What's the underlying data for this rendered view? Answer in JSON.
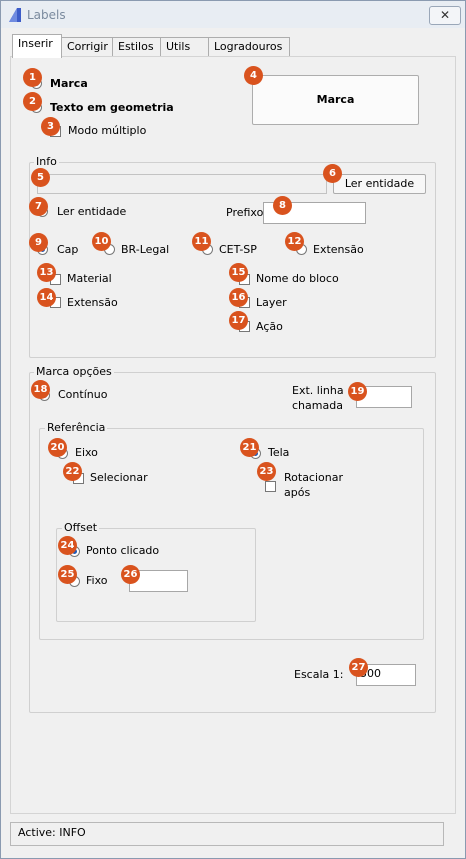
{
  "window": {
    "title": "Labels",
    "close_glyph": "✕"
  },
  "tabs": [
    {
      "label": "Inserir"
    },
    {
      "label": "Corrigir"
    },
    {
      "label": "Estilos"
    },
    {
      "label": "Utils"
    },
    {
      "label": "Logradouros"
    }
  ],
  "top": {
    "marca_label": "Marca",
    "texto_label": "Texto em geometria",
    "modo_label": "Modo múltiplo",
    "marca_button": "Marca"
  },
  "info": {
    "title": "Info",
    "field_value": "",
    "ler_button": "Ler entidade",
    "ler_radio": "Ler entidade",
    "prefixo_label": "Prefixo",
    "prefixo_value": "",
    "opts": {
      "cap": "Cap",
      "brlegal": "BR-Legal",
      "cetsp": "CET-SP",
      "extensao": "Extensão",
      "material": "Material",
      "extensao2": "Extensão",
      "nome_bloco": "Nome do bloco",
      "layer": "Layer",
      "acao": "Ação"
    }
  },
  "marca_opcoes": {
    "title": "Marca opções",
    "continuo": "Contínuo",
    "ext_linha": "Ext. linha",
    "chamada": "chamada",
    "ext_value": "",
    "referencia": {
      "title": "Referência",
      "eixo": "Eixo",
      "tela": "Tela",
      "selecionar": "Selecionar",
      "rotacionar": "Rotacionar",
      "apos": "após"
    },
    "offset": {
      "title": "Offset",
      "ponto": "Ponto clicado",
      "fixo": "Fixo",
      "fixo_value": ""
    },
    "escala_label": "Escala  1:",
    "escala_value": "500"
  },
  "status": {
    "text": "Active: INFO"
  },
  "badges": [
    "1",
    "2",
    "3",
    "4",
    "5",
    "6",
    "7",
    "8",
    "9",
    "10",
    "11",
    "12",
    "13",
    "14",
    "15",
    "16",
    "17",
    "18",
    "19",
    "20",
    "21",
    "22",
    "23",
    "24",
    "25",
    "26",
    "27"
  ],
  "colors": {
    "badge": "#d9531e",
    "radio_dot": "#1e5bb8"
  }
}
